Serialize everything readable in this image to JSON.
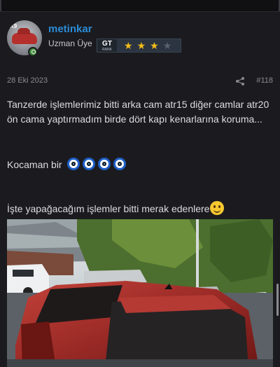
{
  "author": {
    "username": "metinkar",
    "role": "Uzman Üye",
    "rank": {
      "logo": "GT",
      "logo_sub": "RANK",
      "stars_filled": 3,
      "stars_total": 4
    },
    "avatar_tag": "K9",
    "online_icon": "online-status-icon"
  },
  "post": {
    "date": "28 Eki 2023",
    "number": "#118",
    "share_icon": "share-icon",
    "paragraph1": "Tanzerde işlemlerimiz bitti arka cam atr15 diğer camlar atr20 ön cama yaptırmadım birde dört kapı kenarlarına koruma...",
    "paragraph2": "Kocaman bir",
    "paragraph2_emoji": "nazar-bead-emoji",
    "paragraph2_emoji_count": 4,
    "paragraph3": "İşte yapağacağım işlemler bitti merak edenlere",
    "paragraph3_emoji": "smile-emoji",
    "photo": "red-car-rear-photo"
  },
  "colors": {
    "background": "#1b1b1f",
    "username": "#2b8bd6",
    "star": "#f2bd1a",
    "online": "#3f8a3c"
  }
}
